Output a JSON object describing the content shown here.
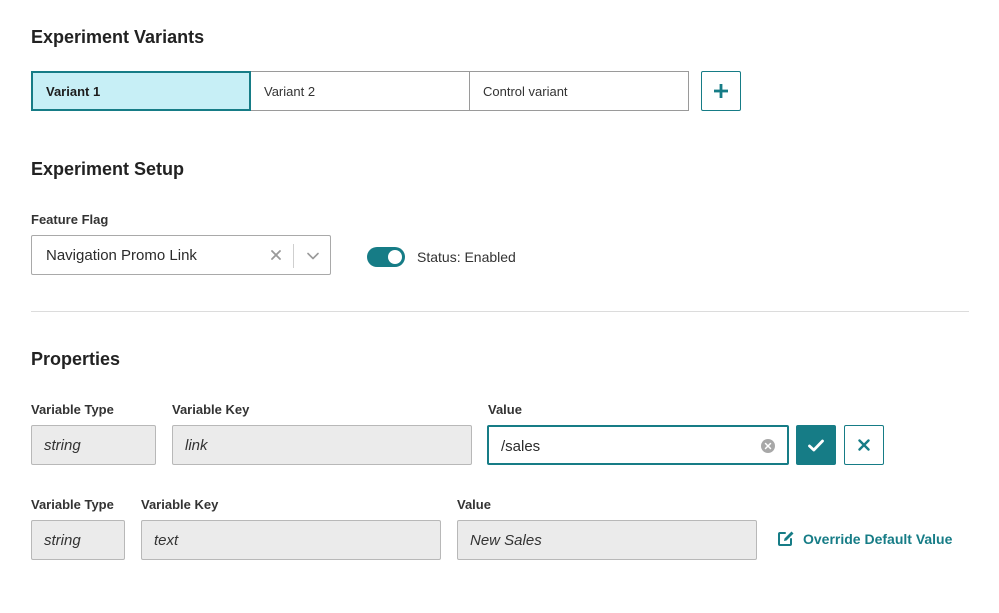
{
  "variants_section": {
    "title": "Experiment Variants",
    "tabs": [
      {
        "label": "Variant 1",
        "active": true
      },
      {
        "label": "Variant 2",
        "active": false
      },
      {
        "label": "Control variant",
        "active": false
      }
    ],
    "add_icon": "plus-icon"
  },
  "setup_section": {
    "title": "Experiment Setup",
    "feature_flag_label": "Feature Flag",
    "feature_flag_value": "Navigation Promo Link",
    "toggle_on": true,
    "status_text": "Status: Enabled"
  },
  "properties_section": {
    "title": "Properties",
    "row1": {
      "type_label": "Variable Type",
      "key_label": "Variable Key",
      "value_label": "Value",
      "type_value": "string",
      "key_value": "link",
      "value_value": "/sales"
    },
    "row2": {
      "type_label": "Variable Type",
      "key_label": "Variable Key",
      "value_label": "Value",
      "type_value": "string",
      "key_value": "text",
      "value_value": "New Sales",
      "override_label": "Override Default Value"
    }
  },
  "colors": {
    "accent": "#167c86",
    "active_tab_bg": "#c7eff6",
    "readonly_bg": "#ebebeb"
  }
}
